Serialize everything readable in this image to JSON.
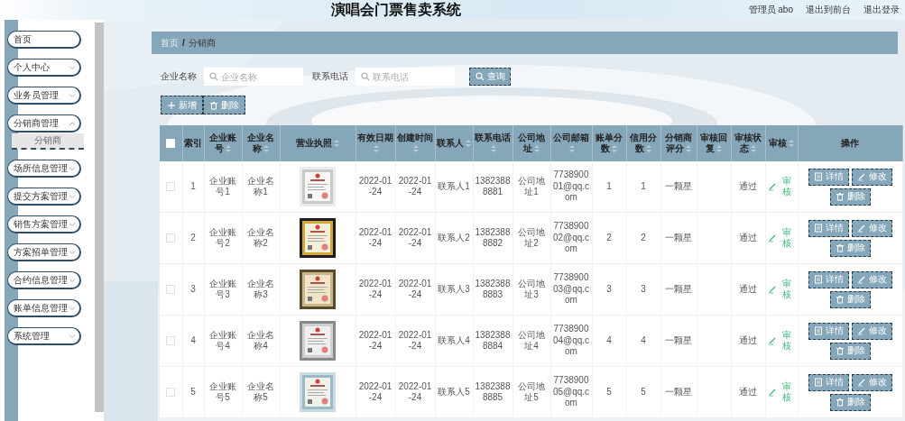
{
  "header": {
    "title": "演唱会门票售卖系统",
    "user": "管理员 abo",
    "links": [
      "退出到前台",
      "退出登录"
    ]
  },
  "sidebar": {
    "items": [
      {
        "label": "首页",
        "kind": "link"
      },
      {
        "label": "个人中心",
        "kind": "menu",
        "expanded": false
      },
      {
        "label": "业务员管理",
        "kind": "menu",
        "expanded": false
      },
      {
        "label": "分销商管理",
        "kind": "menu",
        "expanded": true,
        "children": [
          {
            "label": "分销商",
            "selected": true
          }
        ]
      },
      {
        "label": "场所信息管理",
        "kind": "menu",
        "expanded": false
      },
      {
        "label": "提交方案管理",
        "kind": "menu",
        "expanded": false
      },
      {
        "label": "销售方案管理",
        "kind": "menu",
        "expanded": false
      },
      {
        "label": "方案招单管理",
        "kind": "menu",
        "expanded": false
      },
      {
        "label": "合约信息管理",
        "kind": "menu",
        "expanded": false
      },
      {
        "label": "账单信息管理",
        "kind": "menu",
        "expanded": false
      },
      {
        "label": "系统管理",
        "kind": "menu",
        "expanded": false
      }
    ]
  },
  "breadcrumb": {
    "items": [
      "首页",
      "分销商"
    ],
    "separator": "/"
  },
  "search": {
    "fields": [
      {
        "label": "企业名称",
        "placeholder": "企业名称"
      },
      {
        "label": "联系电话",
        "placeholder": "联系电话"
      }
    ],
    "button": "查询"
  },
  "actions": [
    {
      "kind": "add",
      "label": "新增"
    },
    {
      "kind": "delete",
      "label": "删除"
    }
  ],
  "table": {
    "all_checked": false,
    "columns": [
      {
        "kind": "text",
        "label": "索引",
        "sortable": false
      },
      {
        "kind": "text",
        "label": "企业账号",
        "sortable": true
      },
      {
        "kind": "text",
        "label": "企业名称",
        "sortable": true
      },
      {
        "kind": "picture",
        "label": "营业执照",
        "sortable": true
      },
      {
        "kind": "text",
        "label": "有效日期",
        "sortable": true
      },
      {
        "kind": "text",
        "label": "创建时间",
        "sortable": true
      },
      {
        "kind": "text",
        "label": "联系人",
        "sortable": true
      },
      {
        "kind": "text",
        "label": "联系电话",
        "sortable": true
      },
      {
        "kind": "text",
        "label": "公司地址",
        "sortable": true
      },
      {
        "kind": "text",
        "label": "公司邮箱",
        "sortable": true
      },
      {
        "kind": "text",
        "label": "账单分数",
        "sortable": true
      },
      {
        "kind": "text",
        "label": "信用分数",
        "sortable": true
      },
      {
        "kind": "text",
        "label": "分销商评分",
        "sortable": true
      },
      {
        "kind": "text",
        "label": "审核回复",
        "sortable": true
      },
      {
        "kind": "text",
        "label": "审核状态",
        "sortable": true
      },
      {
        "kind": "review",
        "label": "审核",
        "sortable": true
      },
      {
        "kind": "actions",
        "label": "操作",
        "sortable": false
      }
    ],
    "rows": [
      {
        "checked": false,
        "cells": [
          "1",
          "企业账号1",
          "企业名称1",
          {
            "kind": "picture"
          },
          "2022-01-24",
          "2022-01-24",
          "联系人1",
          "13823888881",
          "公司地址1",
          "773890001@qq.com",
          "1",
          "1",
          "一颗星",
          null,
          "通过",
          "审核",
          [
            {
              "kind": "detail",
              "label": "详情"
            },
            {
              "kind": "edit",
              "label": "修改"
            },
            {
              "kind": "delete",
              "label": "删除"
            }
          ]
        ]
      },
      {
        "checked": false,
        "cells": [
          "2",
          "企业账号2",
          "企业名称2",
          {
            "kind": "picture"
          },
          "2022-01-24",
          "2022-01-24",
          "联系人2",
          "13823888882",
          "公司地址2",
          "773890002@qq.com",
          "2",
          "2",
          "一颗星",
          null,
          "通过",
          "审核",
          [
            {
              "kind": "detail",
              "label": "详情"
            },
            {
              "kind": "edit",
              "label": "修改"
            },
            {
              "kind": "delete",
              "label": "删除"
            }
          ]
        ]
      },
      {
        "checked": false,
        "cells": [
          "3",
          "企业账号3",
          "企业名称3",
          {
            "kind": "picture"
          },
          "2022-01-24",
          "2022-01-24",
          "联系人3",
          "13823888883",
          "公司地址3",
          "773890003@qq.com",
          "3",
          "3",
          "一颗星",
          null,
          "通过",
          "审核",
          [
            {
              "kind": "detail",
              "label": "详情"
            },
            {
              "kind": "edit",
              "label": "修改"
            },
            {
              "kind": "delete",
              "label": "删除"
            }
          ]
        ]
      },
      {
        "checked": false,
        "cells": [
          "4",
          "企业账号4",
          "企业名称4",
          {
            "kind": "picture"
          },
          "2022-01-24",
          "2022-01-24",
          "联系人4",
          "13823888884",
          "公司地址4",
          "773890004@qq.com",
          "4",
          "4",
          "一颗星",
          null,
          "通过",
          "审核",
          [
            {
              "kind": "detail",
              "label": "详情"
            },
            {
              "kind": "edit",
              "label": "修改"
            },
            {
              "kind": "delete",
              "label": "删除"
            }
          ]
        ]
      },
      {
        "checked": false,
        "cells": [
          "5",
          "企业账号5",
          "企业名称5",
          {
            "kind": "picture"
          },
          "2022-01-24",
          "2022-01-24",
          "联系人5",
          "13823888885",
          "公司地址5",
          "773890005@qq.com",
          "5",
          "5",
          "一颗星",
          null,
          "通过",
          "审核",
          [
            {
              "kind": "detail",
              "label": "详情"
            },
            {
              "kind": "edit",
              "label": "修改"
            },
            {
              "kind": "delete",
              "label": "删除"
            }
          ]
        ]
      }
    ]
  }
}
